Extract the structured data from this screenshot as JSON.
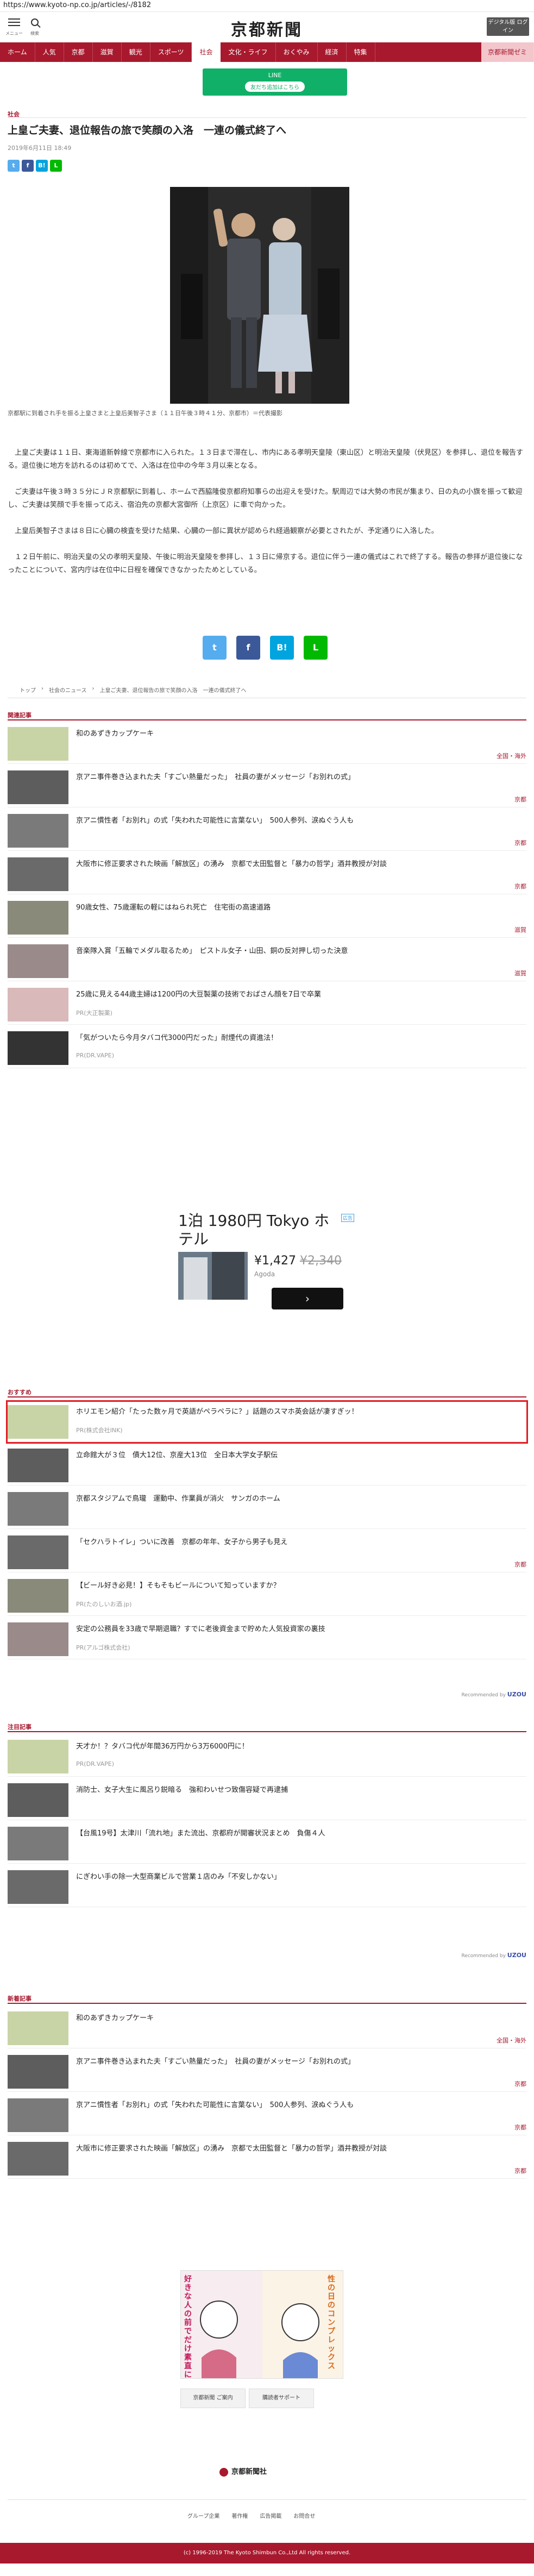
{
  "url": "https://www.kyoto-np.co.jp/articles/-/8182",
  "header": {
    "menu_label": "メニュー",
    "search_label": "検索",
    "logo": "京都新聞",
    "digital_label": "デジタル版 ログイン"
  },
  "gnav": [
    "ホーム",
    "人気",
    "京都",
    "滋賀",
    "観光",
    "スポーツ",
    "社会",
    "文化・ライフ",
    "おくやみ",
    "経済",
    "特集",
    "京都新聞ゼミ"
  ],
  "gnav_active": "社会",
  "green_banner": {
    "title": "LINE",
    "button": "友だち追加はこちら"
  },
  "article": {
    "category": "社会",
    "headline": "上皇ご夫妻、退位報告の旅で笑顔の入洛　一連の儀式終了へ",
    "date": "2019年6月11日 18:49",
    "caption": "京都駅に到着され手を振る上皇さまと上皇后美智子さま（１１日午後３時４１分、京都市）＝代表撮影",
    "paragraphs": [
      "上皇ご夫妻は１１日、東海道新幹線で京都市に入られた。１３日まで滞在し、市内にある孝明天皇陵（東山区）と明治天皇陵（伏見区）を参拝し、退位を報告する。退位後に地方を訪れるのは初めてで、入洛は在位中の今年３月以来となる。",
      "ご夫妻は午後３時３５分にＪＲ京都駅に到着し、ホームで西脇隆俊京都府知事らの出迎えを受けた。駅周辺では大勢の市民が集まり、日の丸の小旗を振って歓迎し、ご夫妻は笑顔で手を振って応え、宿泊先の京都大宮御所（上京区）に車で向かった。",
      "上皇后美智子さまは８日に心臓の検査を受けた結果、心臓の一部に異状が認められ経過観察が必要とされたが、予定通りに入洛した。",
      "１２日午前に、明治天皇の父の孝明天皇陵、午後に明治天皇陵を参拝し、１３日に帰京する。退位に伴う一連の儀式はこれで終了する。報告の参拝が退位後になったことについて、宮内庁は在位中に日程を確保できなかったためとしている。"
    ]
  },
  "breadcrumb": [
    "トップ",
    "社会のニュース",
    "上皇ご夫妻、退位報告の旅で笑顔の入洛　一連の儀式終了へ"
  ],
  "related": {
    "title": "関連記事",
    "items": [
      {
        "title": "和のあずきカップケーキ",
        "tag": "全国・海外"
      },
      {
        "title": "京アニ事件巻き込まれた夫「すごい熱量だった」　社員の妻がメッセージ「お別れの式」",
        "tag": "京都"
      },
      {
        "title": "京アニ慣性者「お別れ」の式「失われた可能性に言葉ない」　500人参列、涙ぬぐう人も",
        "tag": "京都"
      },
      {
        "title": "大阪市に修正要求された映画「解放区」の湧み　京都で太田監督と「暴力の哲学」酒井教授が対談",
        "tag": "京都"
      },
      {
        "title": "90歳女性、75歳運転の軽にはねられ死亡　住宅街の高速道路",
        "tag": "滋賀"
      },
      {
        "title": "音楽隊入賞「五輪でメダル取るため」　ピストル女子・山田、銅の反対押し切った決意",
        "tag": "滋賀"
      },
      {
        "title": "25歳に見える44歳主婦は1200円の大豆製薬の技術でおばさん顔を7日で卒業",
        "sub": "PR(大正製薬)"
      },
      {
        "title": "「気がついたら今月タバコ代3000円だった」耐煙代の資進法！",
        "sub": "PR(DR.VAPE)"
      }
    ]
  },
  "ad": {
    "title": "1泊 1980円 Tokyo ホテル",
    "badge": "広告",
    "price": "¥1,427",
    "old_price": "¥2,340",
    "site": "Agoda",
    "go": "›"
  },
  "recommend": {
    "title": "おすすめ",
    "items": [
      {
        "title": "ホリエモン紹介「たった数ヶ月で英語がペラペラに？」話題のスマホ英会話が凄すぎッ！",
        "sub": "PR(株式会社INK)"
      },
      {
        "title": "立命館大が３位　債大12位、京産大13位　全日本大学女子駅伝",
        "tag": ""
      },
      {
        "title": "京都スタジアムで鳥瓏　運動中、作業員が消火　サンガのホーム",
        "tag": ""
      },
      {
        "title": "「セクハラトイレ」ついに改善　京都の年年、女子から男子も見え",
        "tag": "京都"
      },
      {
        "title": "【ビール好き必見！】そもそもビールについて知っていますか？",
        "sub": "PR(たのしいお酒.jp)"
      },
      {
        "title": "安定の公務員を33歳で早期退職？すでに老後資金まで貯めた人気投資家の裏技",
        "sub": "PR(アルゴ株式会社)"
      }
    ],
    "by": "Recommended by",
    "brand": "UZOU"
  },
  "attention": {
    "title": "注目記事",
    "items": [
      {
        "title": "天才か！？タバコ代が年間36万円から3万6000円に！",
        "sub": "PR(DR.VAPE)"
      },
      {
        "title": "消防士、女子大生に風呂り鋭暗る　強和わいせつ致傷容疑で再逮捕",
        "tag": ""
      },
      {
        "title": "【台風19号】太津川「流れ地」また流出、京都府が開審状況まとめ　負傷４人",
        "tag": ""
      },
      {
        "title": "にぎわい手の除一大型商業ビルで営業１店のみ「不安しかない」",
        "tag": ""
      }
    ],
    "by": "Recommended by",
    "brand": "UZOU"
  },
  "latest": {
    "title": "新着記事",
    "items": [
      {
        "title": "和のあずきカップケーキ",
        "tag": "全国・海外"
      },
      {
        "title": "京アニ事件巻き込まれた夫「すごい熱量だった」　社員の妻がメッセージ「お別れの式」",
        "tag": "京都"
      },
      {
        "title": "京アニ慣性者「お別れ」の式「失われた可能性に言葉ない」　500人参列、涙ぬぐう人も",
        "tag": "京都"
      },
      {
        "title": "大阪市に修正要求された映画「解放区」の湧み　京都で太田監督と「暴力の哲学」酒井教授が対談",
        "tag": "京都"
      }
    ]
  },
  "manga": {
    "left": "好きな人の前でだけ素直になれない",
    "right": "性の日のコンプレックス"
  },
  "footer": {
    "buttons": [
      "京都新聞 ご案内",
      "購読者サポート"
    ],
    "logo": "京都新聞社",
    "links": [
      "グループ企業",
      "著作権",
      "広告掲載",
      "お問合せ"
    ],
    "copyright": "(c) 1996-2019 The Kyoto Shimbun Co.,Ltd All rights reserved."
  },
  "colors": {
    "brand": "#a8192e",
    "line": "#10b068"
  }
}
